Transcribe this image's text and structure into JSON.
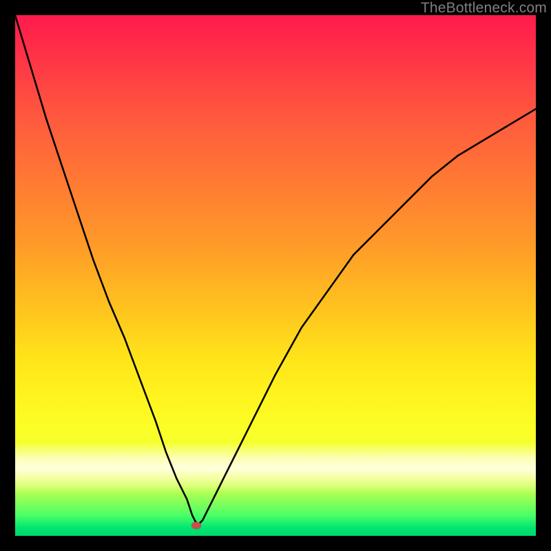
{
  "watermark": "TheBottleneck.com",
  "dot": {
    "x_pct": 34.8,
    "y_pct": 98.0
  },
  "chart_data": {
    "type": "line",
    "title": "",
    "xlabel": "",
    "ylabel": "",
    "xlim": [
      0,
      100
    ],
    "ylim": [
      0,
      100
    ],
    "grid": false,
    "legend": false,
    "annotations": [
      {
        "text": "TheBottleneck.com",
        "position": "top-right"
      }
    ],
    "background_gradient": {
      "orientation": "vertical",
      "stops": [
        {
          "pct": 0,
          "color": "#ff1a4d"
        },
        {
          "pct": 20,
          "color": "#ff5a3e"
        },
        {
          "pct": 44,
          "color": "#ff9a29"
        },
        {
          "pct": 66,
          "color": "#ffe41a"
        },
        {
          "pct": 86,
          "color": "#fbff28"
        },
        {
          "pct": 96,
          "color": "#4dff66"
        },
        {
          "pct": 100,
          "color": "#00d96a"
        }
      ],
      "highlight_band": {
        "center_pct": 86,
        "color": "#fffff0"
      }
    },
    "curve_min_marker": {
      "x": 35,
      "y": 98,
      "color": "#c94f4f"
    },
    "series": [
      {
        "name": "curve",
        "x": [
          0,
          3,
          6,
          9,
          12,
          15,
          18,
          21,
          24,
          27,
          29,
          31,
          33,
          34,
          35,
          36,
          37,
          38.5,
          40,
          43,
          46,
          50,
          55,
          60,
          65,
          70,
          75,
          80,
          85,
          90,
          95,
          100
        ],
        "y": [
          0,
          10,
          20,
          29,
          38,
          47,
          55,
          62,
          70,
          78,
          84,
          89,
          93,
          96,
          98,
          97,
          95,
          92,
          89,
          83,
          77,
          69,
          60,
          53,
          46,
          41,
          36,
          31,
          27,
          24,
          21,
          18
        ]
      }
    ],
    "notes": "x and y are in percent of the plot area measured from the top-left of the gradient region; the curve is a V-shaped bottleneck curve with its minimum (maximum y) near x≈35%."
  }
}
